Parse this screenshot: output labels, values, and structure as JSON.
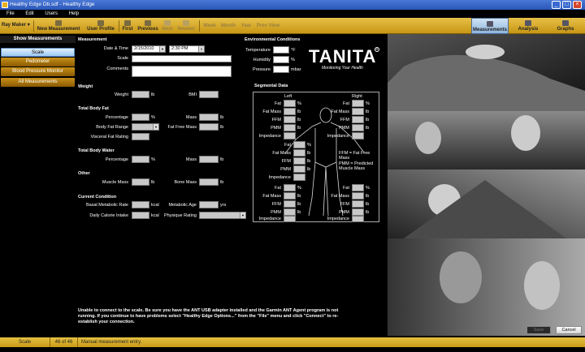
{
  "window": {
    "title": "Healthy Edge Db.sdf - Healthy Edge"
  },
  "menu": [
    "File",
    "Edit",
    "Users",
    "Help"
  ],
  "toolbar": {
    "user": "Ray Maker",
    "new_measurement": "New Measurement",
    "user_profile": "User Profile",
    "first": "First",
    "previous": "Previous",
    "next": "Next",
    "newest": "Newest",
    "week": "Week",
    "month": "Month",
    "year": "Year",
    "prev_view": "Prev View",
    "tabs": {
      "measurements": "Measurements",
      "analysis": "Analysis",
      "graphs": "Graphs"
    }
  },
  "sidebar": {
    "header": "Show Measurements",
    "items": [
      "Scale",
      "Pedometer",
      "Blood Pressure Monitor",
      "All Measurements"
    ],
    "selected": "Scale"
  },
  "measurement": {
    "section": "Measurement",
    "date_time_label": "Date & Time",
    "date": "2/15/2010",
    "time": "2:30 PM",
    "scale_label": "Scale",
    "comments_label": "Comments"
  },
  "weight": {
    "section": "Weight",
    "weight_label": "Weight",
    "weight_unit": "lb",
    "bmi_label": "BMI"
  },
  "body_fat": {
    "section": "Total Body Fat",
    "percentage_label": "Percentage",
    "percentage_unit": "%",
    "mass_label": "Mass",
    "mass_unit": "lb",
    "range_label": "Body Fat Range",
    "fat_free_label": "Fat Free Mass",
    "fat_free_unit": "lb",
    "visceral_label": "Visceral Fat Rating"
  },
  "body_water": {
    "section": "Total Body Water",
    "percentage_label": "Percentage",
    "percentage_unit": "%",
    "mass_label": "Mass",
    "mass_unit": "lb"
  },
  "other": {
    "section": "Other",
    "muscle_label": "Muscle Mass",
    "muscle_unit": "lb",
    "bone_label": "Bone Mass",
    "bone_unit": "lb"
  },
  "current": {
    "section": "Current Condition",
    "bmr_label": "Basal Metabolic Rate",
    "bmr_unit": "kcal",
    "meta_age_label": "Metabolic Age",
    "meta_age_unit": "yrs",
    "calorie_label": "Daily Calorie Intake",
    "calorie_unit": "kcal",
    "physique_label": "Physique Rating"
  },
  "environment": {
    "section": "Environmental Conditions",
    "temperature_label": "Temperature",
    "temperature_unit": "°F",
    "humidity_label": "Humidity",
    "humidity_unit": "%",
    "pressure_label": "Pressure",
    "pressure_unit": "mbar"
  },
  "brand": {
    "logo_text": "TANITA",
    "tagline": "Monitoring Your Health"
  },
  "segmental": {
    "section": "Segmental Data",
    "left_label": "Left",
    "right_label": "Right",
    "fat": "Fat",
    "fat_mass": "Fat Mass",
    "ffm": "FFM",
    "pmm": "PMM",
    "impedance": "Impedance",
    "pct": "%",
    "lb": "lb",
    "legend_ffm": "FFM = Fat Free Mass",
    "legend_pmm": "PMM = Predicted Muscle Mass"
  },
  "message": "Unable to connect to the scale. Be sure you have the ANT USB adapter installed and the Garmin ANT Agent program is not running. If you continue to have problems select \"Healthy Edge Options...\" from the \"File\" menu and click \"Connect\" to re-establish your connection.",
  "buttons": {
    "save": "Save",
    "cancel": "Cancel"
  },
  "status": {
    "view": "Scale",
    "record": "46 of 46",
    "info": "Manual measurement entry."
  },
  "colors": {
    "accent": "#d4a82a",
    "selected": "#b8dcf8"
  }
}
